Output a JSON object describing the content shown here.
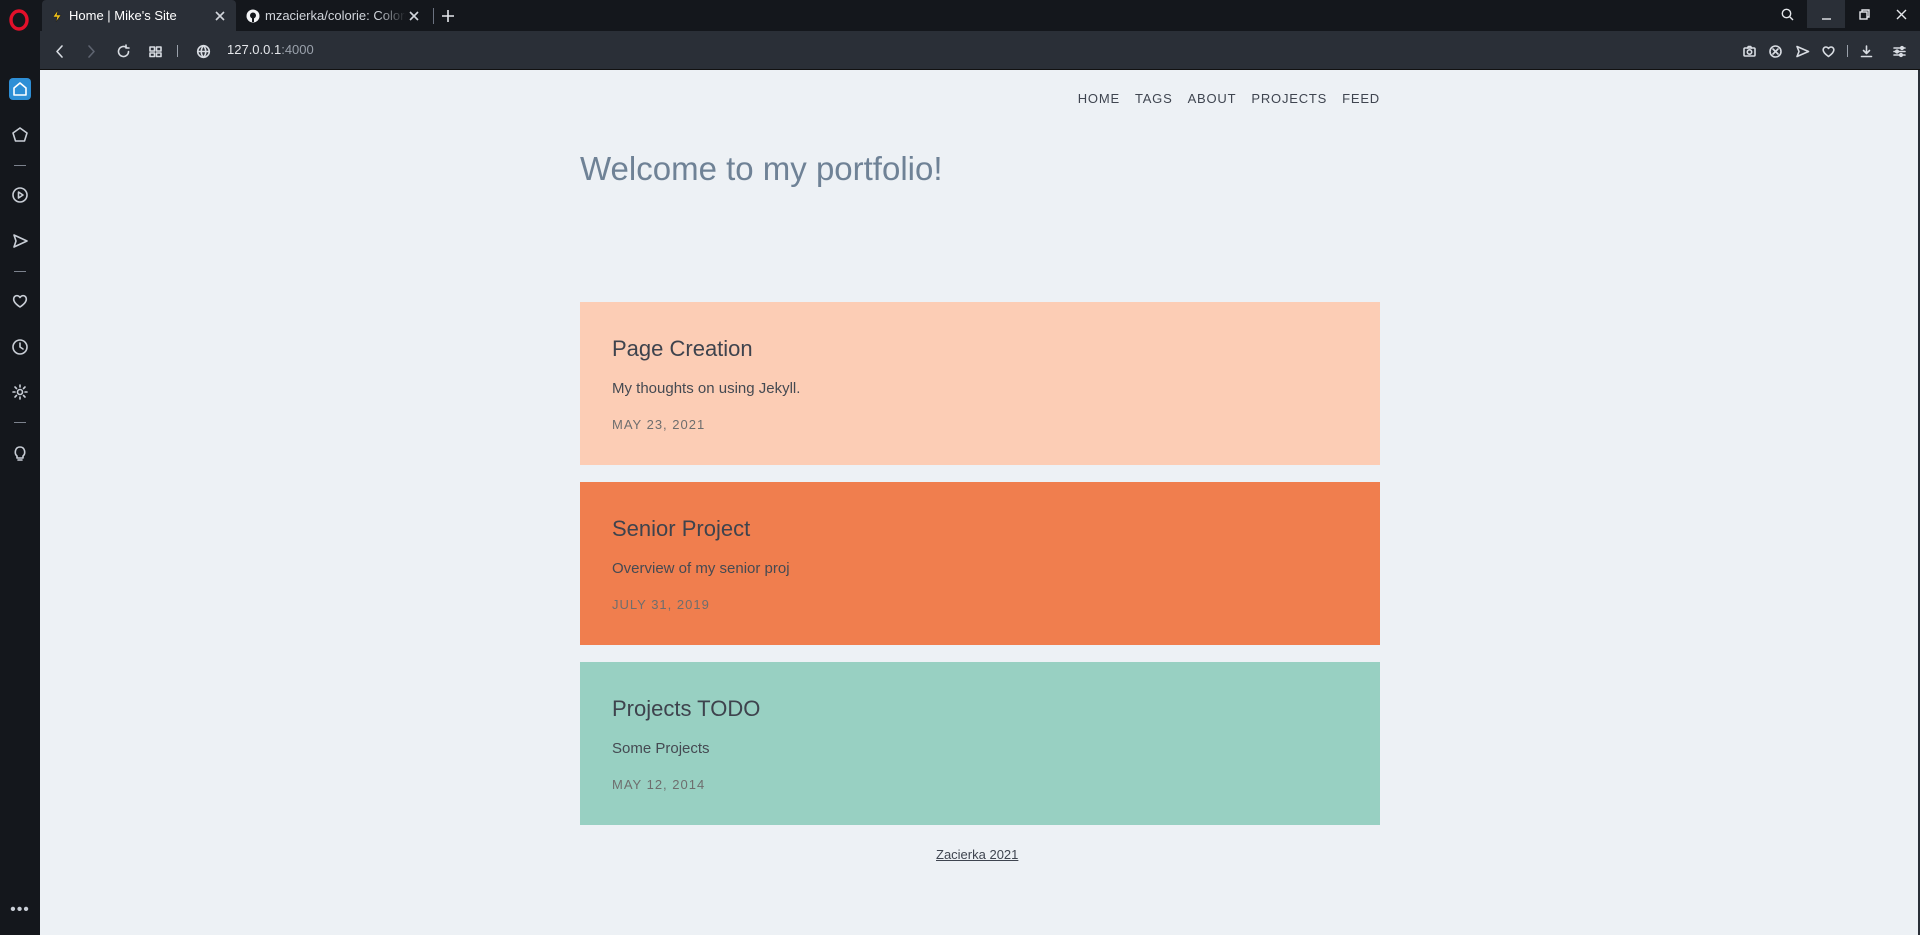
{
  "browser": {
    "tabs": [
      {
        "title": "Home | Mike's Site",
        "active": true
      },
      {
        "title": "mzacierka/colorie: Colorie",
        "active": false
      }
    ],
    "url": {
      "host": "127.0.0.1",
      "port": ":4000"
    }
  },
  "site": {
    "nav": [
      "HOME",
      "TAGS",
      "ABOUT",
      "PROJECTS",
      "FEED"
    ],
    "welcome": "Welcome to my portfolio!",
    "posts": [
      {
        "title": "Page Creation",
        "excerpt": "My thoughts on using Jekyll.",
        "date": "MAY 23, 2021",
        "color": "#fccdb5"
      },
      {
        "title": "Senior Project",
        "excerpt": "Overview of my senior proj",
        "date": "JULY 31, 2019",
        "color": "#f07e4e"
      },
      {
        "title": "Projects TODO",
        "excerpt": "Some Projects",
        "date": "MAY 12, 2014",
        "color": "#98d0c2"
      }
    ],
    "footer": "Zacierka 2021"
  },
  "colors": {
    "page_bg": "#edf1f5",
    "sidebar_bg": "#14171c",
    "toolbar_bg": "#2a2f37",
    "accent": "#2e8fd6"
  }
}
